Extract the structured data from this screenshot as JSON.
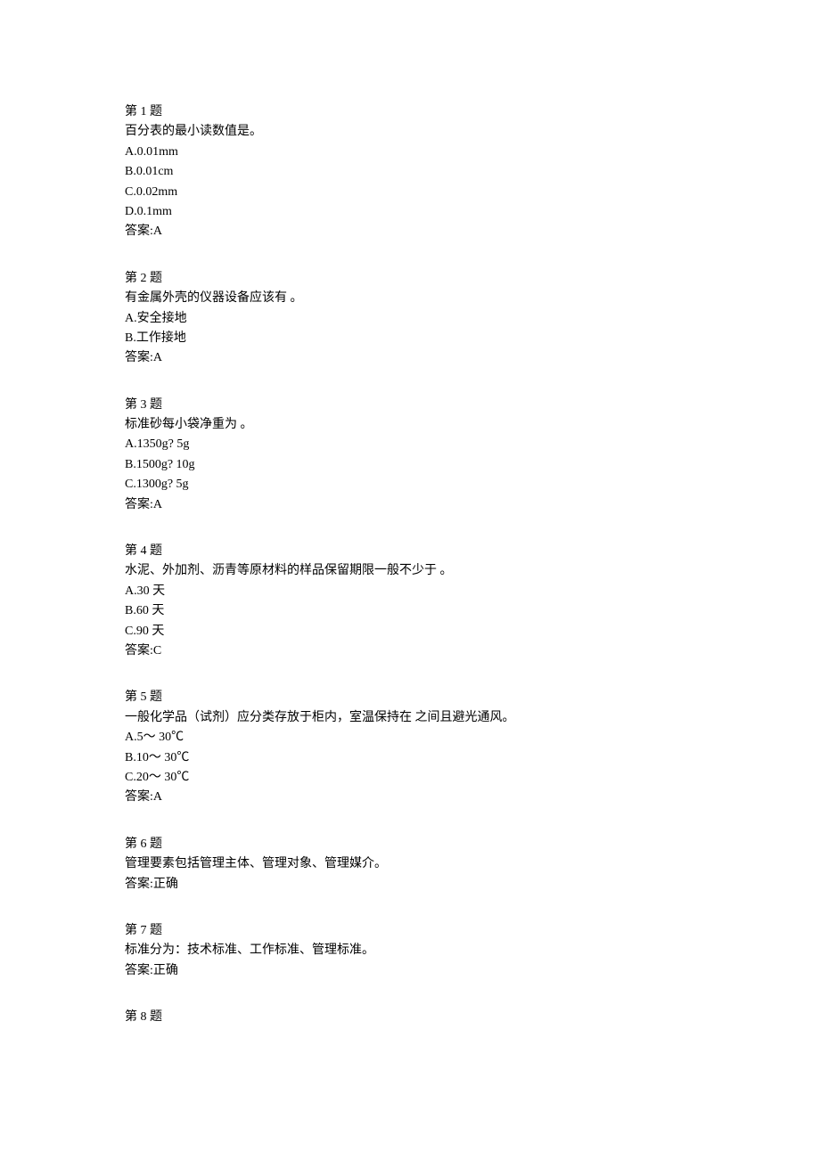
{
  "questions": [
    {
      "header": "第 1 题",
      "stem": "百分表的最小读数值是。",
      "options": [
        "A.0.01mm",
        "B.0.01cm",
        "C.0.02mm",
        "D.0.1mm"
      ],
      "answer": "答案:A"
    },
    {
      "header": "第 2 题",
      "stem": "有金属外壳的仪器设备应该有 。",
      "options": [
        "A.安全接地",
        "B.工作接地"
      ],
      "answer": "答案:A"
    },
    {
      "header": "第 3 题",
      "stem": "标准砂每小袋净重为 。",
      "options": [
        "A.1350g? 5g",
        "B.1500g? 10g",
        "C.1300g? 5g"
      ],
      "answer": "答案:A"
    },
    {
      "header": "第 4 题",
      "stem": "水泥、外加剂、沥青等原材料的样品保留期限一般不少于 。",
      "options": [
        "A.30 天",
        "B.60 天",
        "C.90 天"
      ],
      "answer": "答案:C"
    },
    {
      "header": "第 5 题",
      "stem": "一般化学品（试剂）应分类存放于柜内，室温保持在 之间且避光通风。",
      "options": [
        "A.5～ 30℃",
        "B.10～ 30℃",
        "C.20～ 30℃"
      ],
      "answer": "答案:A"
    },
    {
      "header": "第 6 题",
      "stem": "管理要素包括管理主体、管理对象、管理媒介。",
      "options": [],
      "answer": "答案:正确"
    },
    {
      "header": "第 7 题",
      "stem": "标准分为：技术标准、工作标准、管理标准。",
      "options": [],
      "answer": "答案:正确"
    },
    {
      "header": "第 8 题",
      "stem": "",
      "options": [],
      "answer": ""
    }
  ]
}
